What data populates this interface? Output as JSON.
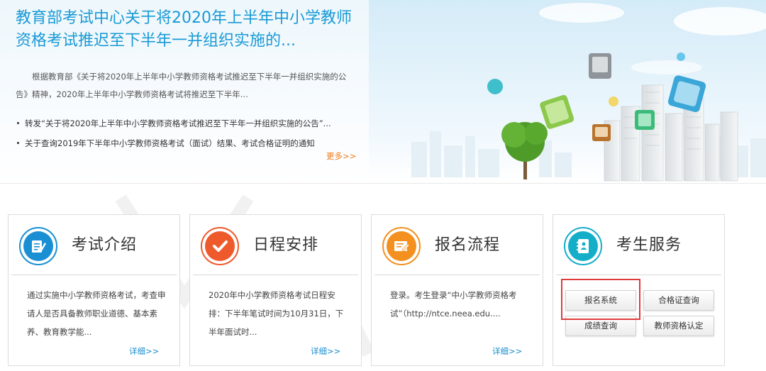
{
  "banner": {
    "headline": "教育部考试中心关于将2020年上半年中小学教师资格考试推迟至下半年一并组织实施的...",
    "summary": "根据教育部《关于将2020年上半年中小学教师资格考试推迟至下半年一并组织实施的公告》精神，2020年上半年中小学教师资格考试将推迟至下半年...",
    "news": [
      "转发“关于将2020年上半年中小学教师资格考试推迟至下半年一并组织实施的公告”...",
      "关于查询2019年下半年中小学教师资格考试（面试）结果、考试合格证明的通知"
    ],
    "more_label": "更多>>"
  },
  "cards": [
    {
      "title": "考试介绍",
      "icon": "exam-doc-icon",
      "color": "#1b8fd4",
      "text": "通过实施中小学教师资格考试，考查申请人是否具备教师职业道德、基本素养、教育教学能...",
      "more_label": "详细>>"
    },
    {
      "title": "日程安排",
      "icon": "checkmark-icon",
      "color": "#ef5a2c",
      "text": "2020年中小学教师资格考试日程安排：下半年笔试时间为10月31日，下半年面试时...",
      "more_label": "详细>>"
    },
    {
      "title": "报名流程",
      "icon": "form-edit-icon",
      "color": "#f39020",
      "text": "登录。考生登录“中小学教师资格考试”（http://ntce.neea.edu....",
      "more_label": "详细>>"
    },
    {
      "title": "考生服务",
      "icon": "address-book-icon",
      "color": "#15aec9",
      "buttons": [
        "报名系统",
        "合格证查询",
        "成绩查询",
        "教师资格认定"
      ]
    }
  ]
}
